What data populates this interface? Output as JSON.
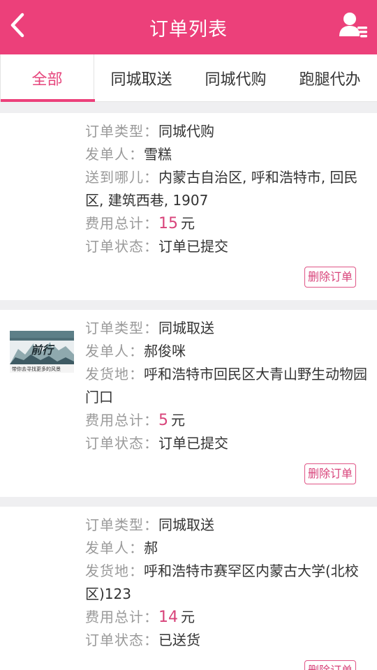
{
  "header": {
    "title": "订单列表",
    "accent_color": "#ec407a",
    "back_icon": "chevron-left-icon",
    "user_icon": "user-list-icon"
  },
  "tabs": [
    {
      "label": "全部",
      "active": true
    },
    {
      "label": "同城取送",
      "active": false
    },
    {
      "label": "同城代购",
      "active": false
    },
    {
      "label": "跑腿代办",
      "active": false
    }
  ],
  "orders": [
    {
      "has_thumb": false,
      "type_label": "订单类型：",
      "type_value": "同城代购",
      "sender_label": "发单人：",
      "sender_value": "雪糕",
      "address_label": "送到哪儿：",
      "address_value": "内蒙古自治区, 呼和浩特市, 回民区, 建筑西巷, 1907",
      "cost_label": "费用总计：",
      "cost_value": "15",
      "cost_unit": "元",
      "status_label": "订单状态：",
      "status_value": "订单已提交",
      "delete_label": "删除订单"
    },
    {
      "has_thumb": true,
      "thumb_title": "前行",
      "thumb_caption": "带你去寻找更多的风景",
      "type_label": "订单类型：",
      "type_value": "同城取送",
      "sender_label": "发单人：",
      "sender_value": "郝俊咪",
      "address_label": "发货地：",
      "address_value": "呼和浩特市回民区大青山野生动物园门口",
      "cost_label": "费用总计：",
      "cost_value": "5",
      "cost_unit": "元",
      "status_label": "订单状态：",
      "status_value": "订单已提交",
      "delete_label": "删除订单"
    },
    {
      "has_thumb": false,
      "type_label": "订单类型：",
      "type_value": "同城取送",
      "sender_label": "发单人：",
      "sender_value": "郝",
      "address_label": "发货地：",
      "address_value": "呼和浩特市赛罕区内蒙古大学(北校区)123",
      "cost_label": "费用总计：",
      "cost_value": "14",
      "cost_unit": "元",
      "status_label": "订单状态：",
      "status_value": "已送货",
      "delete_label": "删除订单"
    }
  ]
}
